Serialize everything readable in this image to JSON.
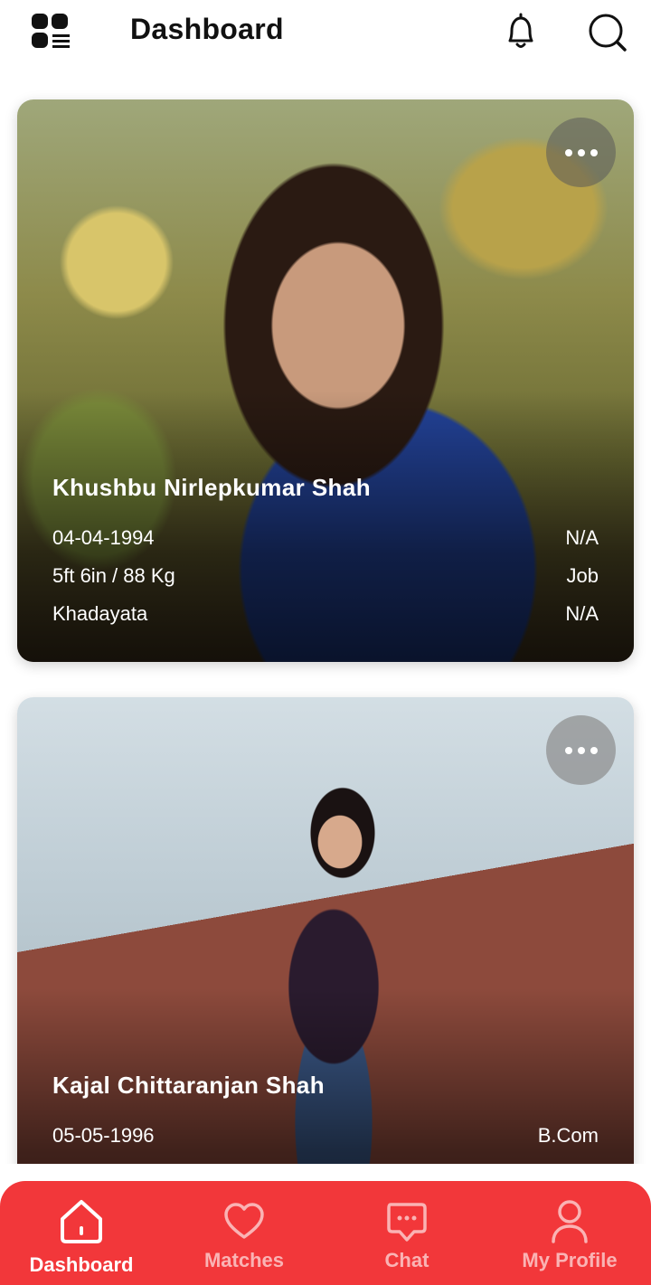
{
  "header": {
    "title": "Dashboard",
    "menu_icon": "grid-list-icon",
    "notification_icon": "bell-icon",
    "search_icon": "search-icon"
  },
  "profiles": [
    {
      "name": "Khushbu  Nirlepkumar  Shah",
      "dob": "04-04-1994",
      "height_weight": "5ft 6in / 88 Kg",
      "community": "Khadayata",
      "education": "N/A",
      "occupation": "Job",
      "income": "N/A"
    },
    {
      "name": "Kajal Chittaranjan  Shah",
      "dob": "05-05-1996",
      "education": "B.Com"
    }
  ],
  "bottom_nav": {
    "items": [
      {
        "label": "Dashboard",
        "icon": "home-icon",
        "active": true
      },
      {
        "label": "Matches",
        "icon": "heart-icon",
        "active": false
      },
      {
        "label": "Chat",
        "icon": "chat-bubble-icon",
        "active": false
      },
      {
        "label": "My Profile",
        "icon": "user-icon",
        "active": false
      }
    ]
  },
  "colors": {
    "accent": "#f2373a",
    "title": "#111111"
  }
}
